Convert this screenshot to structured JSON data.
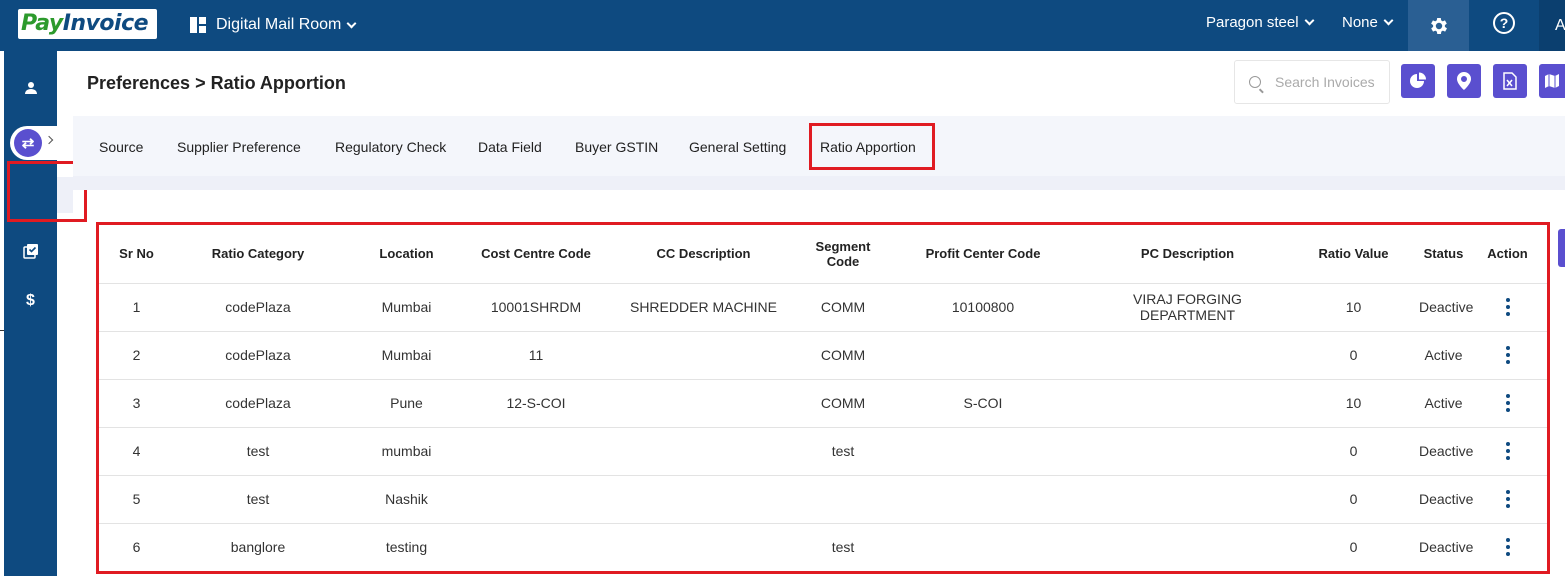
{
  "header": {
    "logo_pay": "Pay",
    "logo_invoice": "Invoice",
    "app_name": "Digital Mail Room",
    "company": "Paragon steel",
    "scope": "None",
    "help": "?",
    "user_initial": "A"
  },
  "sidebar": {
    "items": [
      {
        "icon": "user-icon"
      },
      {
        "icon": "users-icon"
      },
      {
        "icon": "swap-icon",
        "active": true
      },
      {
        "icon": "checklist-icon"
      },
      {
        "icon": "dollar-icon"
      }
    ]
  },
  "page": {
    "title": "Preferences > Ratio Apportion",
    "search_placeholder": "Search Invoices"
  },
  "toolbar": [
    {
      "icon": "pie-chart-icon"
    },
    {
      "icon": "location-pin-icon"
    },
    {
      "icon": "excel-icon"
    },
    {
      "icon": "map-icon"
    }
  ],
  "tabs": [
    {
      "label": "Source"
    },
    {
      "label": "Supplier Preference"
    },
    {
      "label": "Regulatory Check"
    },
    {
      "label": "Data Field"
    },
    {
      "label": "Buyer GSTIN"
    },
    {
      "label": "General Setting"
    },
    {
      "label": "Ratio Apportion",
      "active": true
    }
  ],
  "table": {
    "columns": [
      "Sr No",
      "Ratio Category",
      "Location",
      "Cost Centre Code",
      "CC Description",
      "Segment Code",
      "Profit Center Code",
      "PC Description",
      "Ratio Value",
      "Status",
      "Action"
    ],
    "rows": [
      [
        "1",
        "codePlaza",
        "Mumbai",
        "10001SHRDM",
        "SHREDDER MACHINE",
        "COMM",
        "10100800",
        "VIRAJ FORGING DEPARTMENT",
        "10",
        "Deactive"
      ],
      [
        "2",
        "codePlaza",
        "Mumbai",
        "11",
        "",
        "COMM",
        "",
        "",
        "0",
        "Active"
      ],
      [
        "3",
        "codePlaza",
        "Pune",
        "12-S-COI",
        "",
        "COMM",
        "S-COI",
        "",
        "10",
        "Active"
      ],
      [
        "4",
        "test",
        "mumbai",
        "",
        "",
        "test",
        "",
        "",
        "0",
        "Deactive"
      ],
      [
        "5",
        "test",
        "Nashik",
        "",
        "",
        "",
        "",
        "",
        "0",
        "Deactive"
      ],
      [
        "6",
        "banglore",
        "testing",
        "",
        "",
        "test",
        "",
        "",
        "0",
        "Deactive"
      ]
    ]
  },
  "colors": {
    "brand_navy": "#0e4a80",
    "accent_purple": "#5a4fcf",
    "highlight_red": "#e01b22",
    "logo_green": "#2c9a2c"
  }
}
